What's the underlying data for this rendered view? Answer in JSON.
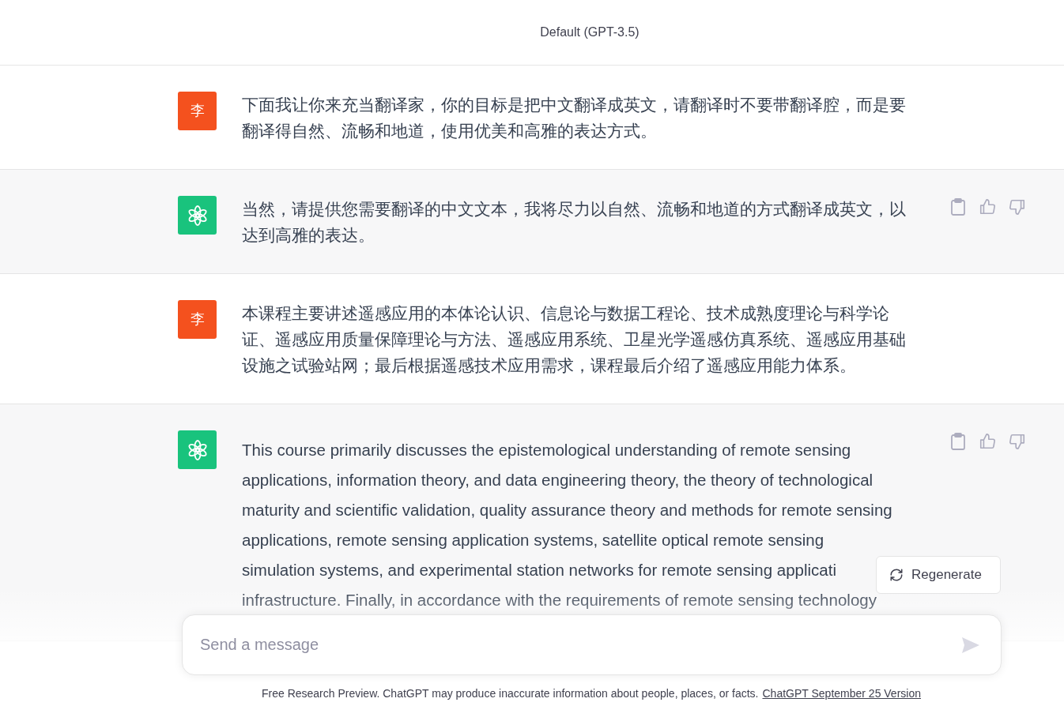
{
  "header": {
    "title": "Default (GPT-3.5)"
  },
  "messages": [
    {
      "kind": "user",
      "avatar": "李",
      "lines": [
        "下面我让你来充当翻译家，你的目标是把中文翻译成英文，请翻译时不要带翻译腔，而是要",
        "翻译得自然、流畅和地道，使用优美和高雅的表达方式。"
      ]
    },
    {
      "kind": "assistant",
      "lines": [
        "当然，请提供您需要翻译的中文文本，我将尽力以自然、流畅和地道的方式翻译成英文，以",
        "达到高雅的表达。"
      ]
    },
    {
      "kind": "user",
      "avatar": "李",
      "lines": [
        "本课程主要讲述遥感应用的本体论认识、信息论与数据工程论、技术成熟度理论与科学论",
        "证、遥感应用质量保障理论与方法、遥感应用系统、卫星光学遥感仿真系统、遥感应用基础",
        "设施之试验站网；最后根据遥感技术应用需求，课程最后介绍了遥感应用能力体系。"
      ]
    },
    {
      "kind": "assistant",
      "lines": [
        "This course primarily discusses the epistemological understanding of remote sensing",
        "applications, information theory, and data engineering theory, the theory of technological",
        "maturity and scientific validation, quality assurance theory and methods for remote sensing",
        "applications, remote sensing application systems, satellite optical remote sensing",
        "simulation systems, and experimental station networks for remote sensing applicati",
        "infrastructure. Finally, in accordance with the requirements of remote sensing technology"
      ]
    }
  ],
  "regenerate": {
    "label": "Regenerate"
  },
  "composer": {
    "placeholder": "Send a message"
  },
  "footer": {
    "text": "Free Research Preview. ChatGPT may produce inaccurate information about people, places, or facts.",
    "link": "ChatGPT September 25 Version"
  }
}
